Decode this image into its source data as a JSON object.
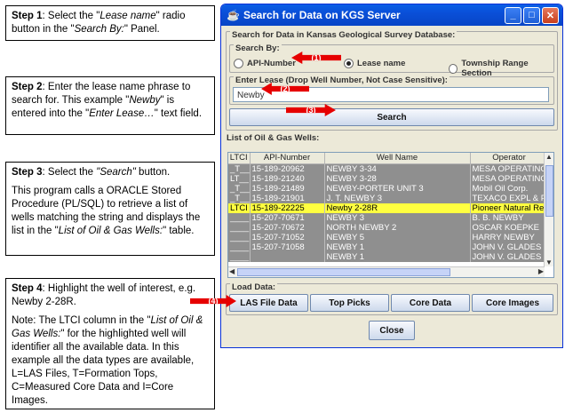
{
  "notes": {
    "step1": {
      "bold": "Step 1",
      "pre": ": Select the \"",
      "em1": "Lease name",
      "mid": "\" radio button in the \"",
      "em2": "Search By:",
      "post": "\" Panel."
    },
    "step2": {
      "bold": "Step 2",
      "pre": ": Enter the lease name phrase to search for. This example \"",
      "em1": "Newby",
      "mid": "\" is entered into the \"",
      "em2": "Enter Lease…",
      "post": "\" text field."
    },
    "step3": {
      "bold": "Step 3",
      "pre": ": Select the ",
      "em1": "\"Search\"",
      "post": " button.",
      "para2": "This program calls a ORACLE Stored Procedure (PL/SQL) to retrieve a list of wells matching the string and displays the list in the \"",
      "para2_em": "List of Oil & Gas Wells:",
      "para2_post": "\" table."
    },
    "step4": {
      "bold": "Step 4",
      "pre": ": Highlight the well of interest, e.g. Newby 2-28R.",
      "para2_pre": "Note: The LTCI column in the \"",
      "para2_em": "List of Oil & Gas Wells:",
      "para2_post": "\" for the highlighted well will identifier all the available data. In this example all the data types are available, L=LAS Files, T=Formation Tops, C=Measured Core Data and I=Core Images."
    }
  },
  "window": {
    "title": "Search for Data on KGS Server",
    "icon": "java-cup-icon",
    "outer_group": "Search for Data in Kansas Geological Survey Database:",
    "search_by": {
      "label": "Search By:",
      "options": [
        "API-Number",
        "Lease name",
        "Township Range Section"
      ],
      "selected": "Lease name"
    },
    "lease": {
      "label": "Enter Lease (Drop Well Number, Not Case Sensitive):",
      "value": "Newby"
    },
    "search_button": "Search",
    "wells": {
      "label": "List of Oil & Gas Wells:",
      "columns": [
        "LTCI",
        "API-Number",
        "Well Name",
        "Operator"
      ],
      "rows": [
        [
          "_T__",
          "15-189-20962",
          "NEWBY 3-34",
          "MESA OPERATING"
        ],
        [
          "LT__",
          "15-189-21240",
          "NEWBY 3-28",
          "MESA OPERATING"
        ],
        [
          "_T__",
          "15-189-21489",
          "NEWBY-PORTER UNIT 3",
          "Mobil Oil Corp."
        ],
        [
          "_T__",
          "15-189-21901",
          "J. T. NEWBY 3",
          "TEXACO EXPL & PROD"
        ],
        [
          "LTCI",
          "15-189-22225",
          "Newby 2-28R",
          "Pioneer Natural Resou"
        ],
        [
          "____",
          "15-207-70671",
          "NEWBY 3",
          "B. B. NEWBY"
        ],
        [
          "____",
          "15-207-70672",
          "NORTH NEWBY 2",
          "OSCAR KOEPKE"
        ],
        [
          "____",
          "15-207-71052",
          "NEWBY 5",
          "HARRY NEWBY"
        ],
        [
          "____",
          "15-207-71058",
          "NEWBY 1",
          "JOHN V. GLADES"
        ],
        [
          "____",
          "",
          "NEWBY 1",
          "JOHN V. GLADES"
        ]
      ],
      "selected_row": 4
    },
    "load_data": {
      "label": "Load Data:",
      "buttons": [
        "LAS File Data",
        "Top Picks",
        "Core Data",
        "Core Images"
      ]
    },
    "close_button": "Close"
  },
  "callouts": [
    "(1)",
    "(2)",
    "(3)",
    "(4)"
  ],
  "colors": {
    "title_bar": "#0a54dc",
    "selected_row": "#ffff40",
    "row_bg": "#8f8f8f",
    "callout": "#e60000"
  }
}
